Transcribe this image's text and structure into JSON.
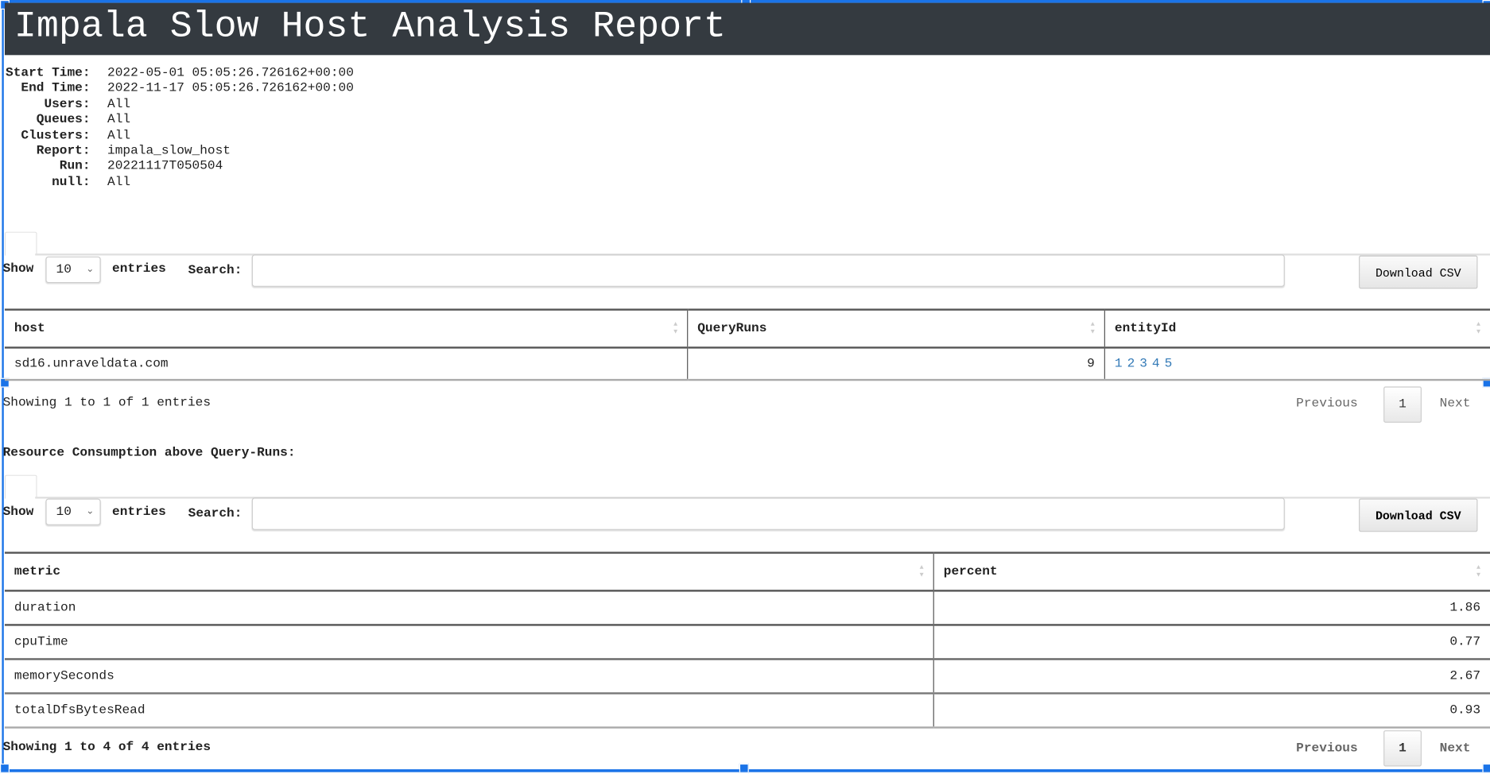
{
  "header": {
    "title": "Impala Slow Host Analysis Report"
  },
  "meta": [
    {
      "label": "Start Time:",
      "value": "2022-05-01 05:05:26.726162+00:00"
    },
    {
      "label": "End Time:",
      "value": "2022-11-17 05:05:26.726162+00:00"
    },
    {
      "label": "Users:",
      "value": "All"
    },
    {
      "label": "Queues:",
      "value": "All"
    },
    {
      "label": "Clusters:",
      "value": "All"
    },
    {
      "label": "Report:",
      "value": "impala_slow_host"
    },
    {
      "label": "Run:",
      "value": "20221117T050504"
    },
    {
      "label": "null:",
      "value": "All"
    }
  ],
  "table1": {
    "show_label": "Show",
    "page_size": "10",
    "entries_label": "entries",
    "search_label": "Search:",
    "search_value": "",
    "download_label": "Download CSV",
    "columns": [
      "host",
      "QueryRuns",
      "entityId"
    ],
    "rows": [
      {
        "host": "sd16.unraveldata.com",
        "QueryRuns": "9",
        "entityId": [
          "1",
          "2",
          "3",
          "4",
          "5"
        ]
      }
    ],
    "info": "Showing 1 to 1 of 1 entries",
    "pagination": {
      "previous": "Previous",
      "current": "1",
      "next": "Next"
    }
  },
  "section2_title": "Resource Consumption above Query-Runs:",
  "table2": {
    "show_label": "Show",
    "page_size": "10",
    "entries_label": "entries",
    "search_label": "Search:",
    "search_value": "",
    "download_label": "Download CSV",
    "columns": [
      "metric",
      "percent"
    ],
    "rows": [
      {
        "metric": "duration",
        "percent": "1.86"
      },
      {
        "metric": "cpuTime",
        "percent": "0.77"
      },
      {
        "metric": "memorySeconds",
        "percent": "2.67"
      },
      {
        "metric": "totalDfsBytesRead",
        "percent": "0.93"
      }
    ],
    "info": "Showing 1 to 4 of 4 entries",
    "pagination": {
      "previous": "Previous",
      "current": "1",
      "next": "Next"
    }
  },
  "colors": {
    "header_bg": "#343a40",
    "link": "#337ab7",
    "selection": "#1a73e8"
  }
}
